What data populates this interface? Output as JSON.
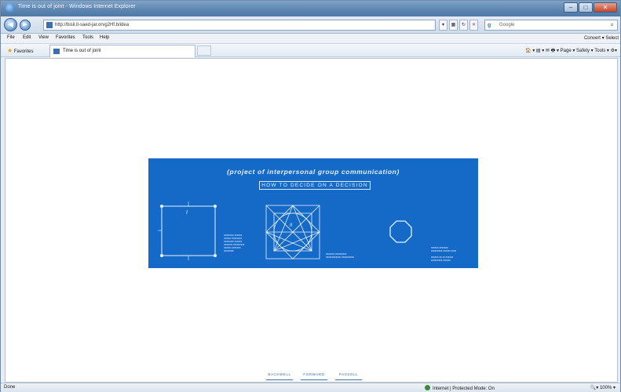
{
  "browser": {
    "window_title": "Time is out of joint - Windows Internet Explorer",
    "url": "http://bisil.it-saed-jar.orvg2Hf.b/idea",
    "search_placeholder": "Google",
    "menu": [
      "File",
      "Edit",
      "View",
      "Favorites",
      "Tools",
      "Help"
    ],
    "menu_right": "Convert ▾  Select",
    "favorites_label": "Favorites",
    "tab_title": "Time is out of joint",
    "command_bar": "Page ▾  Safety ▾  Tools ▾",
    "status_left": "Done",
    "status_zone": "Internet | Protected Mode: On",
    "status_zoom": "100%"
  },
  "banner": {
    "title": "(project of interpersonal group communication)",
    "subtitle": "HOW TO DECIDE ON A DECISION",
    "square_label": "I",
    "star_label": "II",
    "block1": "xxxxxxxx xxxxxx\nxxxxxx xxxxxxxx\nxxxxxxxx xxxxxx\nxxxxxxx xxxxxxxxx\nxxxxxx xxxxxxx\nxxxxxxxx",
    "block2": "xxxxxxx xxxxxxxxx\nxxxxxxxxxxxx xxxxxxxxxx",
    "block3": "xxxxxx xxxxxxx\nxxxxxxxxx xxxxxx xxxx\n\nxxxxxx xx xx xxxxxx\nxxxxxxxxx xxxxxx"
  },
  "bottom_nav": [
    "BACKWELL",
    "FORWARD",
    "PASSOLL"
  ],
  "colors": {
    "banner_blue": "#1569c7",
    "line_white": "#e8f2ff"
  }
}
